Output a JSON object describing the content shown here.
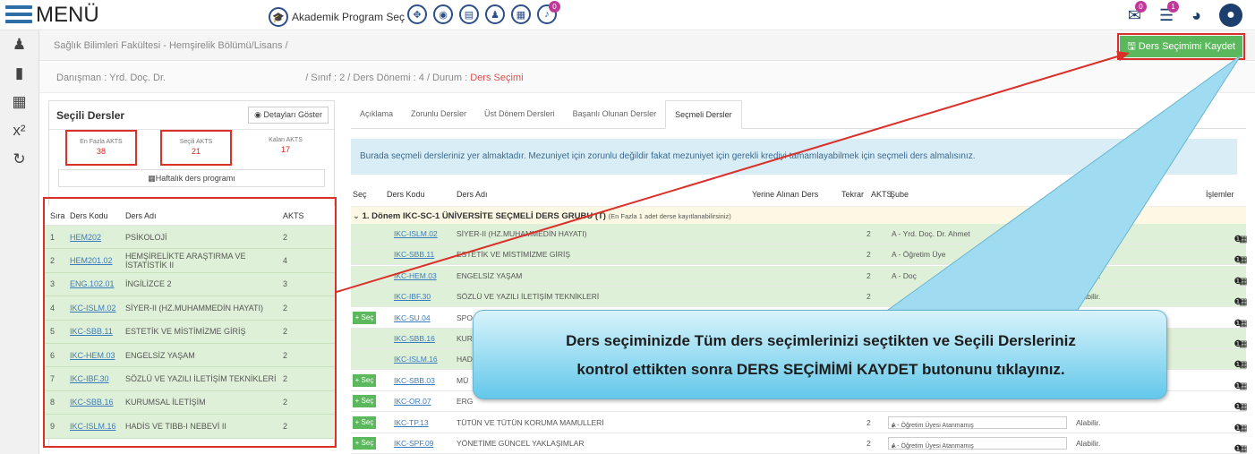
{
  "topbar": {
    "menu_label": "MENÜ",
    "program_select": "Akademik Program Seç",
    "icon_badges": [
      "",
      "",
      "",
      "",
      "",
      "0"
    ],
    "mail_badge": "0",
    "list_badge": "1"
  },
  "breadcrumb": {
    "faculty": "Sağlık Bilimleri Fakültesi - Hemşirelik Bölümü/Lisans",
    "sep": "/"
  },
  "save_button": "Ders Seçimimi Kaydet",
  "subbar": {
    "advisor": "Danışman : Yrd. Doç. Dr. ",
    "class": "/ Sınıf : 2",
    "term": "/ Ders Dönemi : 4",
    "status_label": "/ Durum :",
    "status_value": "Ders Seçimi"
  },
  "selected_courses": {
    "title": "Seçili Dersler",
    "details_button": "Detayları Göster",
    "stats": [
      {
        "label": "En Fazla AKTS",
        "value": "38"
      },
      {
        "label": "Seçili AKTS",
        "value": "21"
      },
      {
        "label": "Kalan AKTS",
        "value": "17"
      }
    ],
    "weekly_button": "Haftalık ders programı",
    "columns": [
      "Sıra",
      "Ders Kodu",
      "Ders Adı",
      "AKTS"
    ],
    "rows": [
      {
        "no": "1",
        "code": "HEM202",
        "name": "PSİKOLOJİ",
        "akts": "2"
      },
      {
        "no": "2",
        "code": "HEM201.02",
        "name": "HEMŞİRELİKTE ARAŞTIRMA VE İSTATİSTİK II",
        "akts": "4"
      },
      {
        "no": "3",
        "code": "ENG.102.01",
        "name": "İNGİLİZCE 2",
        "akts": "3"
      },
      {
        "no": "4",
        "code": "IKC-ISLM.02",
        "name": "SİYER-II (HZ.MUHAMMEDİN HAYATI)",
        "akts": "2"
      },
      {
        "no": "5",
        "code": "IKC-SBB.11",
        "name": "ESTETİK VE MİSTİMİZME GİRİŞ",
        "akts": "2"
      },
      {
        "no": "6",
        "code": "IKC-HEM.03",
        "name": "ENGELSİZ YAŞAM",
        "akts": "2"
      },
      {
        "no": "7",
        "code": "IKC-IBF.30",
        "name": "SÖZLÜ VE YAZILI İLETİŞİM TEKNİKLERİ",
        "akts": "2"
      },
      {
        "no": "8",
        "code": "IKC-SBB.16",
        "name": "KURUMSAL İLETİŞİM",
        "akts": "2"
      },
      {
        "no": "9",
        "code": "IKC-ISLM.16",
        "name": "HADİS VE TIBB-I NEBEVİ II",
        "akts": "2"
      }
    ]
  },
  "tabs": [
    "Açıklama",
    "Zorunlu Dersler",
    "Üst Dönem Dersleri",
    "Başarılı Olunan Dersler",
    "Seçmeli Dersler"
  ],
  "info_text": "Burada seçmeli dersleriniz yer almaktadır. Mezuniyet için zorunlu değildir fakat mezuniyet için gerekli krediyi tamamlayabilmek için seçmeli ders almalısınız.",
  "electives": {
    "columns": {
      "sec": "Seç",
      "code": "Ders Kodu",
      "name": "Ders Adı",
      "instead": "Yerine Alınan Ders",
      "repeat": "Tekrar",
      "akts": "AKTS",
      "branch": "Şube",
      "ops": "İşlemler"
    },
    "group_title": "1. Dönem IKC-SC-1 ÜNİVERSİTE SEÇMELİ DERS GRUBU (T)",
    "group_note": "(En Fazla 1 adet derse kayıtlanabilirsiniz)",
    "select_label": "+ Seç",
    "rows": [
      {
        "selectable": false,
        "code": "IKC-ISLM.02",
        "name": "SİYER-II (HZ.MUHAMMEDİN HAYATI)",
        "akts": "2",
        "branch": "A - Yrd. Doç. Dr. Ahmet",
        "status": "Alabilir."
      },
      {
        "selectable": false,
        "code": "IKC-SBB.11",
        "name": "ESTETİK VE MİSTİMİZME GİRİŞ",
        "akts": "2",
        "branch": "A - Öğretim Üye",
        "status": "Alabilir."
      },
      {
        "selectable": false,
        "code": "IKC-HEM.03",
        "name": "ENGELSİZ YAŞAM",
        "akts": "2",
        "branch": "A - Doç",
        "status": "Alabilir."
      },
      {
        "selectable": false,
        "code": "IKC-IBF.30",
        "name": "SÖZLÜ VE YAZILI İLETİŞİM TEKNİKLERİ",
        "akts": "2",
        "branch": "",
        "status": "Alabilir."
      },
      {
        "selectable": true,
        "code": "IKC-SU.04",
        "name": "SPO",
        "akts": "",
        "branch": "",
        "status": ""
      },
      {
        "selectable": false,
        "code": "IKC-SBB.16",
        "name": "KUR",
        "akts": "",
        "branch": "",
        "status": ""
      },
      {
        "selectable": false,
        "code": "IKC-ISLM.16",
        "name": "HAD",
        "akts": "",
        "branch": "",
        "status": ""
      },
      {
        "selectable": true,
        "code": "IKC-SBB.03",
        "name": "MÜ",
        "akts": "",
        "branch": "",
        "status": ""
      },
      {
        "selectable": true,
        "code": "IKC-OR.07",
        "name": "ERG",
        "akts": "",
        "branch": "",
        "status": ""
      },
      {
        "selectable": true,
        "code": "IKC-TP.13",
        "name": "TÜTÜN VE TÜTÜN KORUMA MAMULLERİ",
        "akts": "2",
        "branch": "A - Öğretim Üyesi Atanmamış",
        "status": "Alabilir."
      },
      {
        "selectable": true,
        "code": "IKC-SPF.09",
        "name": "YÖNETİME GÜNCEL YAKLAŞIMLAR",
        "akts": "2",
        "branch": "A - Öğretim Üyesi Atanmamış",
        "status": "Alabilir."
      }
    ]
  },
  "callout": {
    "line1": "Ders seçiminizde Tüm ders seçimlerinizi seçtikten ve Seçili Dersleriniz",
    "line2": "kontrol ettikten sonra DERS SEÇİMİMİ KAYDET butonunu tıklayınız."
  },
  "colors": {
    "accent": "#2d6ea8",
    "save": "#5cb85c",
    "highlight": "#d9302a",
    "row_green": "#dff0d8",
    "callout": "#63c8ea"
  }
}
